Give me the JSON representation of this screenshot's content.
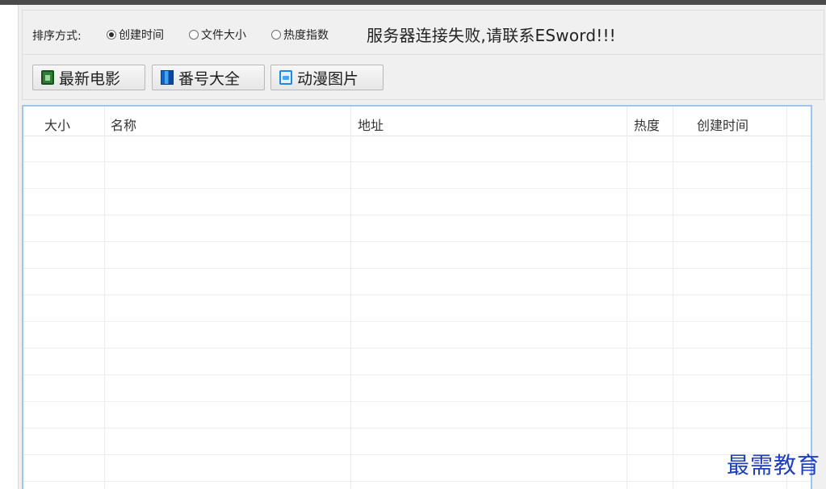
{
  "sort": {
    "label": "排序方式:",
    "options": [
      {
        "label": "创建时间",
        "selected": true
      },
      {
        "label": "文件大小",
        "selected": false
      },
      {
        "label": "热度指数",
        "selected": false
      }
    ]
  },
  "status_message": "服务器连接失败,请联系ESword!!!",
  "toolbar": {
    "buttons": [
      {
        "label": "最新电影",
        "icon": "film-icon"
      },
      {
        "label": "番号大全",
        "icon": "grid-icon"
      },
      {
        "label": "动漫图片",
        "icon": "picture-icon"
      }
    ]
  },
  "table": {
    "columns": [
      "大小",
      "名称",
      "地址",
      "热度",
      "创建时间"
    ],
    "rows": []
  },
  "watermark": "最需教育",
  "colors": {
    "title_bar": "#4a4a4a",
    "grid_border": "#9ec5f2",
    "watermark": "#1f3fbf"
  }
}
